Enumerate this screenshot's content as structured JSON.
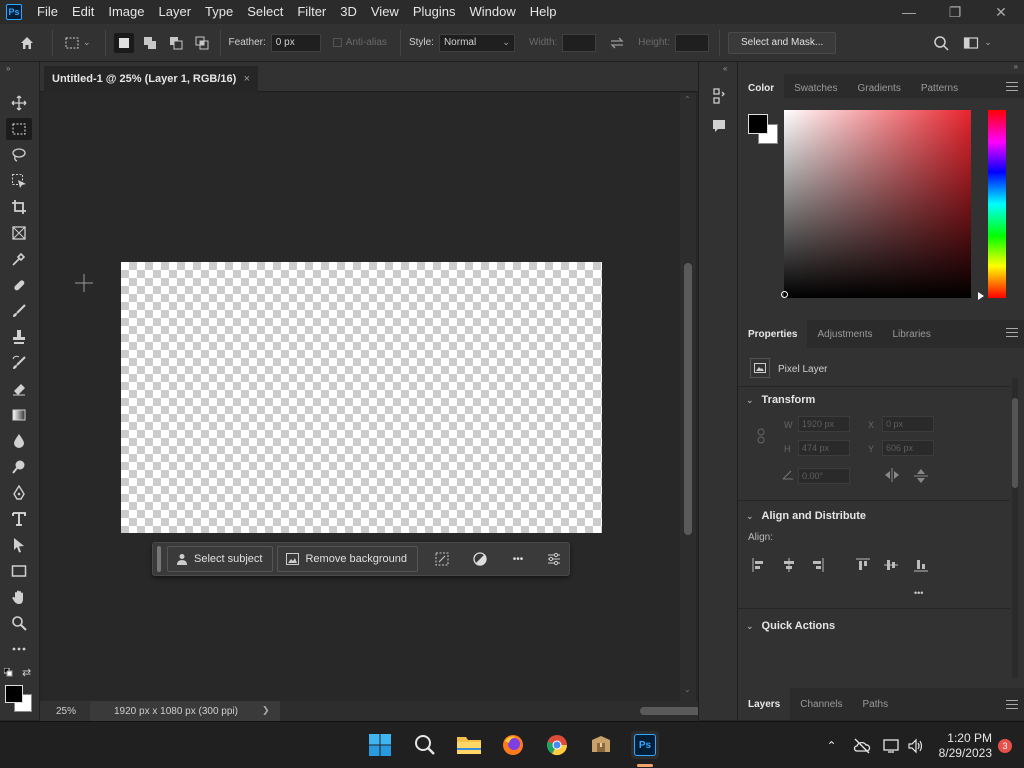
{
  "menubar": {
    "app_logo": "Ps",
    "items": [
      "File",
      "Edit",
      "Image",
      "Layer",
      "Type",
      "Select",
      "Filter",
      "3D",
      "View",
      "Plugins",
      "Window",
      "Help"
    ],
    "window_controls": [
      "—",
      "❐",
      "✕"
    ]
  },
  "options_bar": {
    "feather_label": "Feather:",
    "feather_value": "0 px",
    "antialias_label": "Anti-alias",
    "style_label": "Style:",
    "style_value": "Normal",
    "width_label": "Width:",
    "height_label": "Height:",
    "select_mask_label": "Select and Mask..."
  },
  "document": {
    "tab_title": "Untitled-1 @ 25% (Layer 1, RGB/16)",
    "close_glyph": "×"
  },
  "context_bar": {
    "select_subject_label": "Select subject",
    "remove_background_label": "Remove background",
    "more_glyph": "•••"
  },
  "status_bar": {
    "zoom": "25%",
    "doc_info": "1920 px x 1080 px (300 ppi)",
    "arrow": "❯"
  },
  "color_panel": {
    "tabs": [
      "Color",
      "Swatches",
      "Gradients",
      "Patterns"
    ],
    "foreground": "#000000",
    "background": "#ffffff",
    "hue_color": "#e8242d"
  },
  "properties_panel": {
    "tabs": [
      "Properties",
      "Adjustments",
      "Libraries"
    ],
    "layer_kind": "Pixel Layer",
    "transform": {
      "title": "Transform",
      "w_label": "W",
      "w_value": "1920 px",
      "h_label": "H",
      "h_value": "474 px",
      "x_label": "X",
      "x_value": "0 px",
      "y_label": "Y",
      "y_value": "606 px",
      "angle_value": "0.00°"
    },
    "align": {
      "title": "Align and Distribute",
      "align_label": "Align:",
      "more_glyph": "•••"
    },
    "quick_actions_title": "Quick Actions"
  },
  "layers_panel": {
    "tabs": [
      "Layers",
      "Channels",
      "Paths"
    ]
  },
  "taskbar": {
    "time": "1:20 PM",
    "date": "8/29/2023",
    "notifications": "3"
  }
}
